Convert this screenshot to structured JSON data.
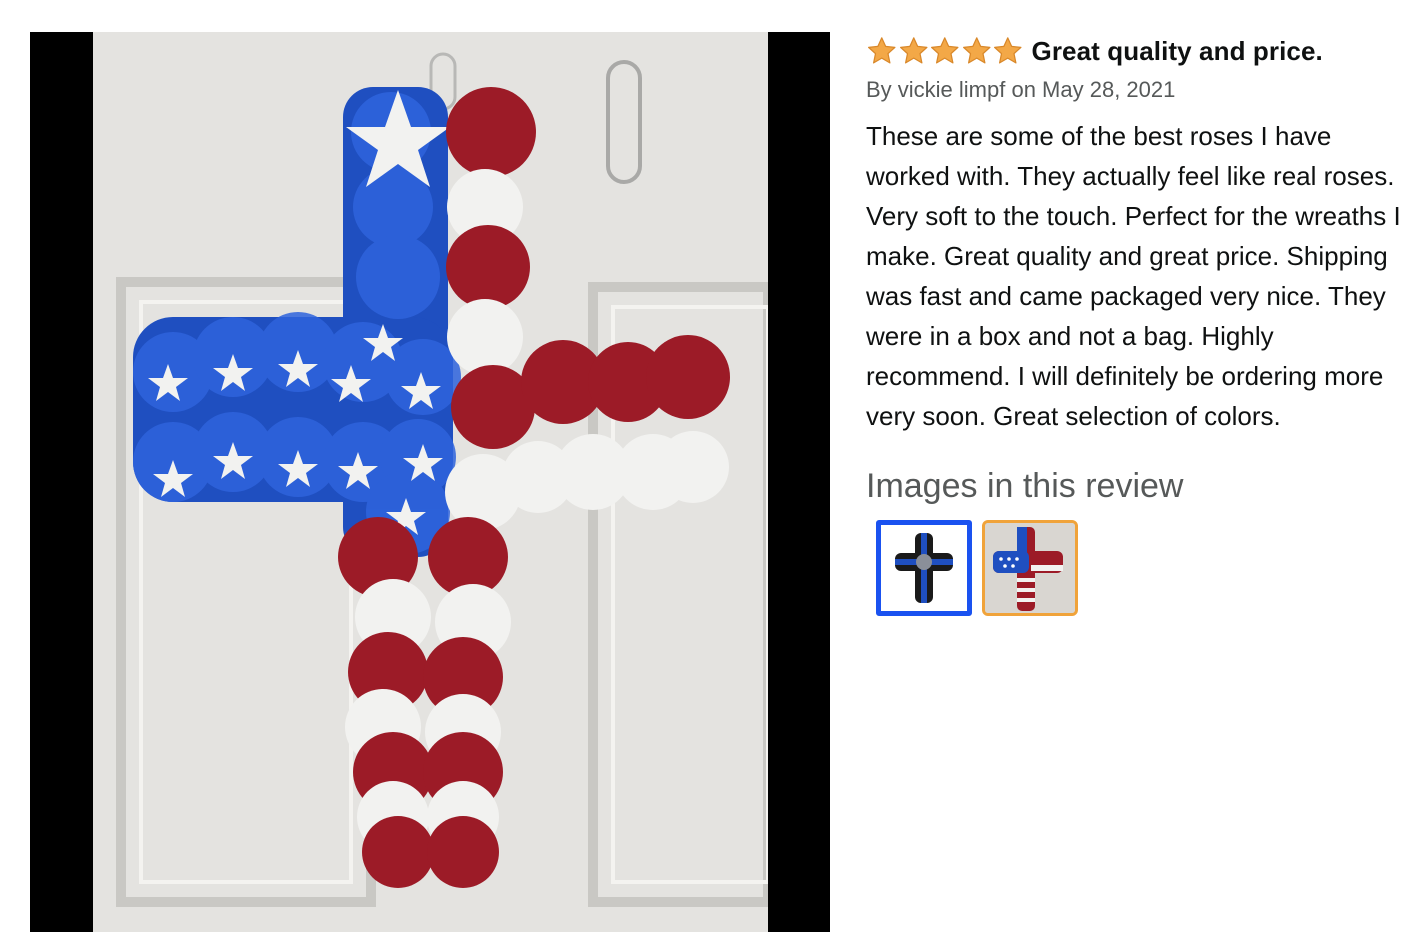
{
  "review": {
    "rating": 5,
    "rating_max": 5,
    "title": "Great quality and price.",
    "byline": "By vickie limpf on May 28, 2021",
    "body": "These are some of the best roses I have worked with. They actually feel like real roses. Very soft to the touch. Perfect for the wreaths I make. Great quality and great price. Shipping was fast and came packaged very nice. They were in a box and not a bag. Highly recommend. I will definitely be ordering more very soon. Great selection of colors."
  },
  "images_section": {
    "heading": "Images in this review",
    "thumbnails": [
      {
        "name": "thumbnail-blue-line-cross",
        "selected_color": "#1a52f0"
      },
      {
        "name": "thumbnail-flag-rose-cross",
        "selected_color": "#f0a33a"
      }
    ]
  },
  "colors": {
    "star": "#f3a847",
    "star_outline": "#d9882a",
    "rose_blue": "#1f4fc0",
    "rose_red": "#9c1b27",
    "rose_white": "#f2f2f0"
  }
}
